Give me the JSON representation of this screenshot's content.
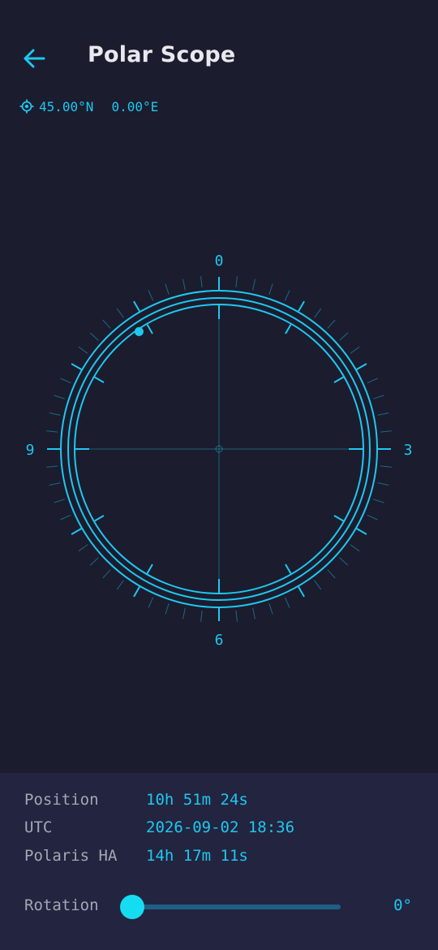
{
  "header": {
    "title": "Polar Scope",
    "back_icon": "arrow-left-icon"
  },
  "location": {
    "icon": "gps-target-icon",
    "lat": "45.00°N",
    "lon": "0.00°E"
  },
  "scope": {
    "labels": {
      "top": "0",
      "right": "3",
      "bottom": "6",
      "left": "9"
    },
    "polaris_clock_hours": 10.857,
    "color": "#1ec8f0"
  },
  "info": {
    "position_label": "Position",
    "position_value": "10h 51m 24s",
    "utc_label": "UTC",
    "utc_value": "2026-09-02 18:36",
    "ha_label": "Polaris HA",
    "ha_value": "14h 17m 11s"
  },
  "rotation": {
    "label": "Rotation",
    "value_text": "0°",
    "value": 0
  },
  "colors": {
    "background": "#1b1c2e",
    "panel": "#23243f",
    "accent": "#1ec8f0",
    "track": "#1e5f86"
  }
}
